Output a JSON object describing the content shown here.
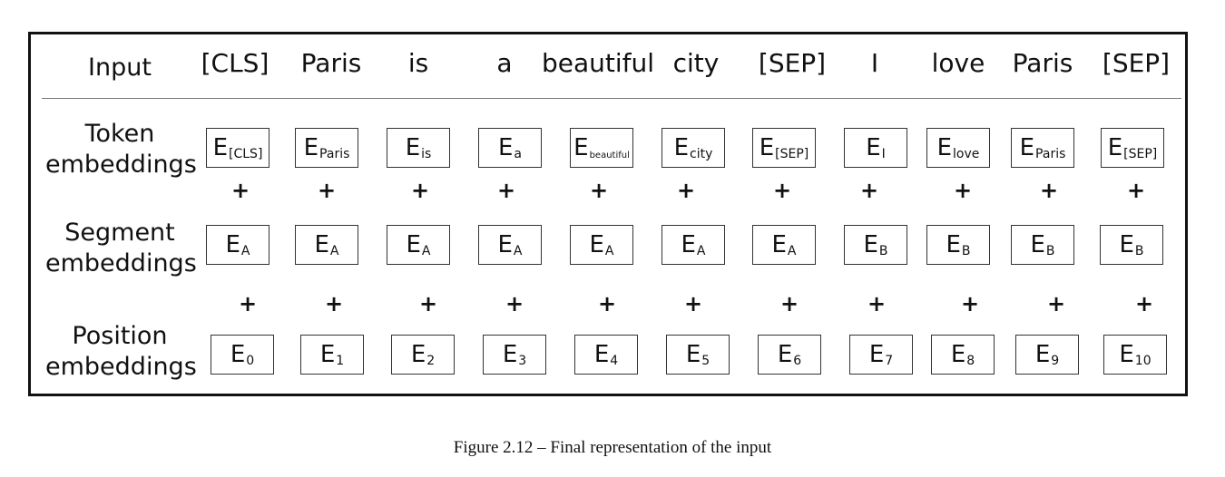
{
  "rows": {
    "input_label": "Input",
    "token_label": [
      "Token",
      "embeddings"
    ],
    "segment_label": [
      "Segment",
      "embeddings"
    ],
    "position_label": [
      "Position",
      "embeddings"
    ]
  },
  "input_tokens": [
    "[CLS]",
    "Paris",
    "is",
    "a",
    "beautiful",
    "city",
    "[SEP]",
    "I",
    "love",
    "Paris",
    "[SEP]"
  ],
  "token_embeddings": [
    {
      "main": "E",
      "sub": "[CLS]"
    },
    {
      "main": "E",
      "sub": "Paris"
    },
    {
      "main": "E",
      "sub": "is"
    },
    {
      "main": "E",
      "sub": "a"
    },
    {
      "main": "E",
      "sub": "beautiful"
    },
    {
      "main": "E",
      "sub": "city"
    },
    {
      "main": "E",
      "sub": "[SEP]"
    },
    {
      "main": "E",
      "sub": "I"
    },
    {
      "main": "E",
      "sub": "love"
    },
    {
      "main": "E",
      "sub": "Paris"
    },
    {
      "main": "E",
      "sub": "[SEP]"
    }
  ],
  "segment_embeddings": [
    {
      "main": "E",
      "sub": "A"
    },
    {
      "main": "E",
      "sub": "A"
    },
    {
      "main": "E",
      "sub": "A"
    },
    {
      "main": "E",
      "sub": "A"
    },
    {
      "main": "E",
      "sub": "A"
    },
    {
      "main": "E",
      "sub": "A"
    },
    {
      "main": "E",
      "sub": "A"
    },
    {
      "main": "E",
      "sub": "B"
    },
    {
      "main": "E",
      "sub": "B"
    },
    {
      "main": "E",
      "sub": "B"
    },
    {
      "main": "E",
      "sub": "B"
    }
  ],
  "position_embeddings": [
    {
      "main": "E",
      "sub": "0"
    },
    {
      "main": "E",
      "sub": "1"
    },
    {
      "main": "E",
      "sub": "2"
    },
    {
      "main": "E",
      "sub": "3"
    },
    {
      "main": "E",
      "sub": "4"
    },
    {
      "main": "E",
      "sub": "5"
    },
    {
      "main": "E",
      "sub": "6"
    },
    {
      "main": "E",
      "sub": "7"
    },
    {
      "main": "E",
      "sub": "8"
    },
    {
      "main": "E",
      "sub": "9"
    },
    {
      "main": "E",
      "sub": "10"
    }
  ],
  "plus_symbol": "+",
  "caption": "Figure 2.12 – Final representation of the input"
}
